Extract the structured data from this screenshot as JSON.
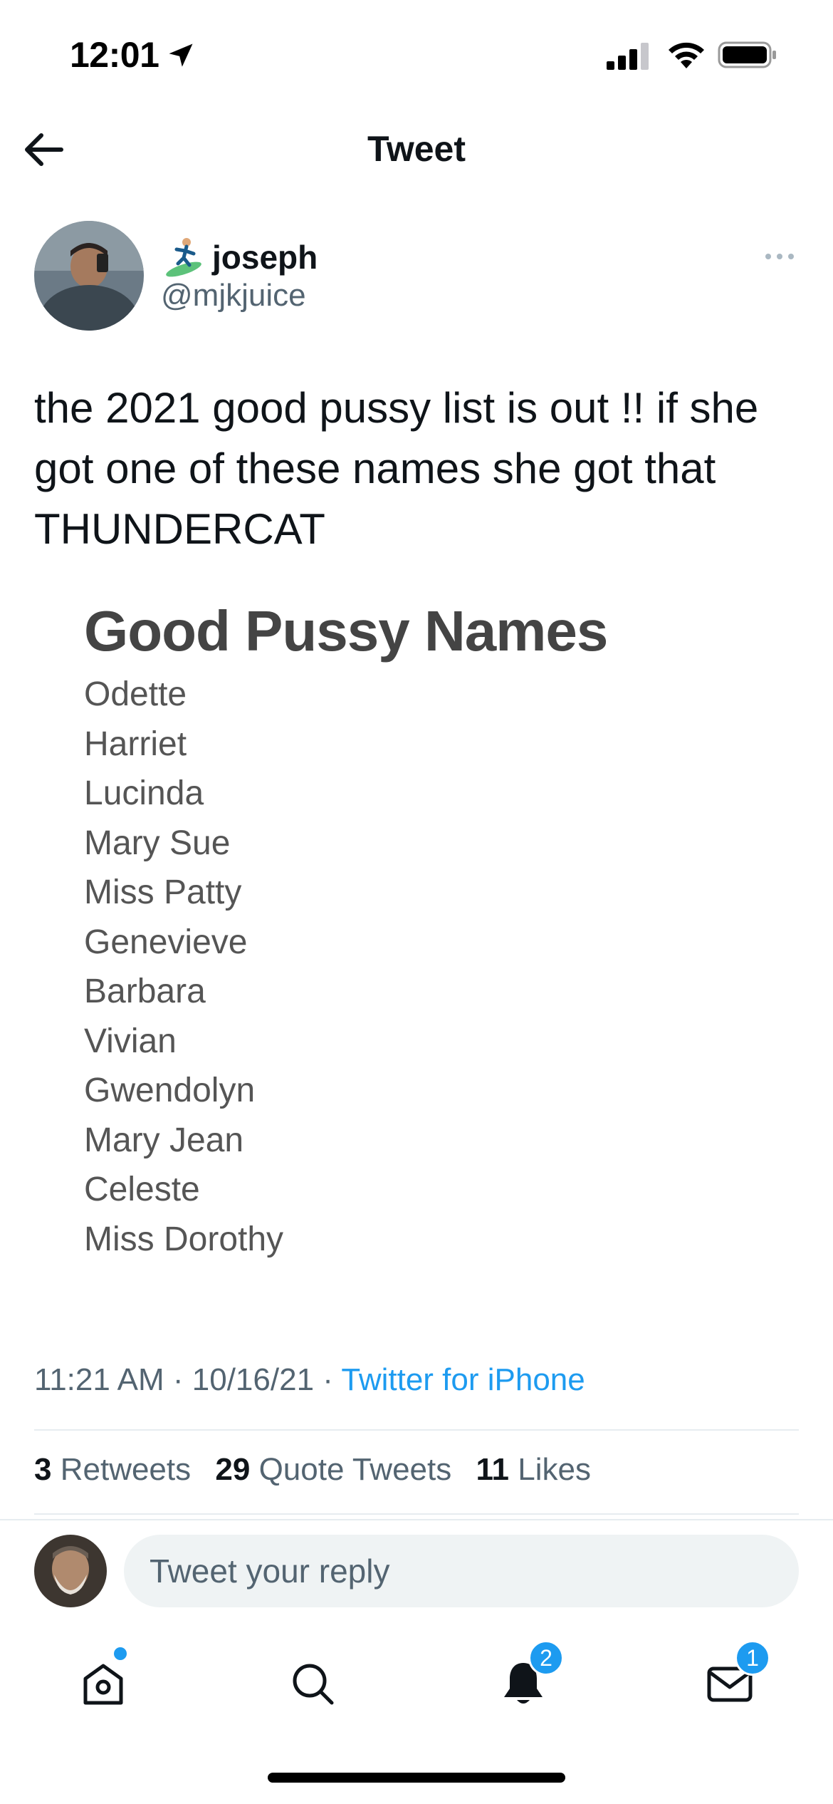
{
  "status_bar": {
    "time": "12:01"
  },
  "nav": {
    "title": "Tweet"
  },
  "tweet": {
    "author_name": "joseph",
    "author_handle": "@mjkjuice",
    "text": "the 2021 good pussy list is out !! if she got one of these names she got that THUNDERCAT",
    "media": {
      "title": "Good Pussy Names",
      "names": [
        "Odette",
        "Harriet",
        "Lucinda",
        "Mary Sue",
        "Miss Patty",
        "Genevieve",
        "Barbara",
        "Vivian",
        "Gwendolyn",
        "Mary Jean",
        "Celeste",
        "Miss Dorothy"
      ]
    },
    "time": "11:21 AM",
    "separator": "·",
    "date": "10/16/21",
    "source": "Twitter for iPhone",
    "stats": {
      "retweets_count": "3",
      "retweets_label": "Retweets",
      "quotes_count": "29",
      "quotes_label": "Quote Tweets",
      "likes_count": "11",
      "likes_label": "Likes"
    }
  },
  "reply": {
    "placeholder": "Tweet your reply"
  },
  "tabbar": {
    "notifications_badge": "2",
    "messages_badge": "1"
  },
  "colors": {
    "accent": "#1d9bf0",
    "secondary_text": "#536471"
  }
}
